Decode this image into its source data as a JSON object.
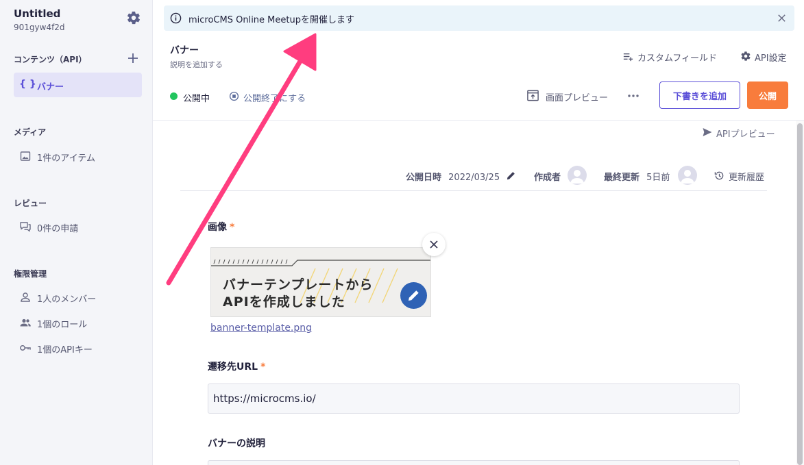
{
  "sidebar": {
    "project_name": "Untitled",
    "project_id": "901gyw4f2d",
    "sections": {
      "contents_heading": "コンテンツ（API）",
      "media_heading": "メディア",
      "review_heading": "レビュー",
      "permissions_heading": "権限管理"
    },
    "api_item": {
      "icon_text": "{ }",
      "label": "バナー"
    },
    "media_item": {
      "label": "1件のアイテム",
      "icon": "image-icon"
    },
    "review_item": {
      "label": "0件の申請",
      "icon": "chat-icon"
    },
    "members_item": {
      "label": "1人のメンバー",
      "icon": "person-icon"
    },
    "roles_item": {
      "label": "1個のロール",
      "icon": "group-icon"
    },
    "apikeys_item": {
      "label": "1個のAPIキー",
      "icon": "key-icon"
    }
  },
  "announcement": {
    "text": "microCMS Online Meetupを開催します"
  },
  "header": {
    "title": "バナー",
    "subtitle": "説明を追加する",
    "custom_field_label": "カスタムフィールド",
    "api_settings_label": "API設定",
    "status_label": "公開中",
    "end_publish_label": "公開終了にする",
    "screen_preview_label": "画面プレビュー",
    "add_draft_label": "下書きを追加",
    "publish_label": "公開"
  },
  "content": {
    "api_preview_label": "APIプレビュー",
    "meta": {
      "publish_date_label": "公開日時",
      "publish_date_value": "2022/03/25",
      "author_label": "作成者",
      "updated_label": "最終更新",
      "updated_value": "5日前",
      "history_label": "更新履歴"
    },
    "image_field": {
      "label": "画像",
      "required_mark": "*",
      "image_text_line1": "バナーテンプレートから",
      "image_text_line2": "APIを作成しました",
      "filename": "banner-template.png"
    },
    "url_field": {
      "label": "遷移先URL",
      "required_mark": "*",
      "value": "https://microcms.io/"
    },
    "description_field": {
      "label": "バナーの説明"
    }
  },
  "colors": {
    "accent": "#5b4fd8",
    "publish_button": "#f87c3c",
    "status_green": "#22c55e",
    "annotation_arrow": "#ff3d7f",
    "edit_button": "#2f62b5"
  }
}
